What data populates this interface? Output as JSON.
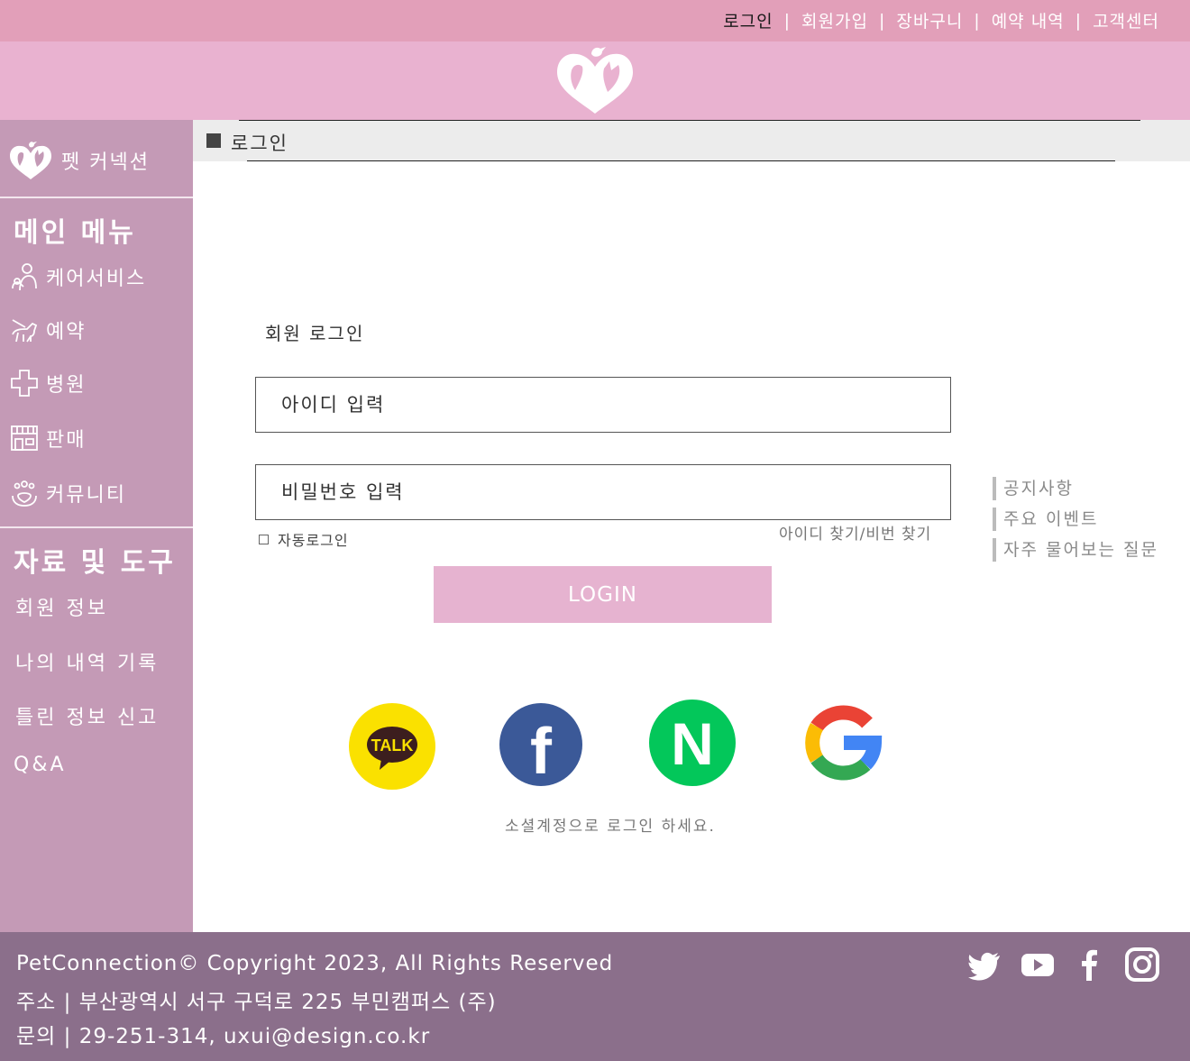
{
  "topnav": {
    "items": [
      "로그인",
      "회원가입",
      "장바구니",
      "예약 내역",
      "고객센터"
    ],
    "separator": "|"
  },
  "sidebar": {
    "brand": "펫 커넥션",
    "main_title": "메인 메뉴",
    "main_items": [
      {
        "label": "케어서비스",
        "icon": "caregiver-icon"
      },
      {
        "label": "예약",
        "icon": "dog-walk-icon"
      },
      {
        "label": "병원",
        "icon": "medical-cross-icon"
      },
      {
        "label": "판매",
        "icon": "store-icon"
      },
      {
        "label": "커뮤니티",
        "icon": "community-icon"
      }
    ],
    "tools_title": "자료 및 도구",
    "tool_items": [
      "회원 정보",
      "나의 내역 기록",
      "틀린 정보 신고",
      "Q&A"
    ]
  },
  "breadcrumb": {
    "label": "로그인"
  },
  "login": {
    "title": "회원 로그인",
    "id_placeholder": "아이디 입력",
    "pw_placeholder": "비밀번호 입력",
    "auto_login": "자동로그인",
    "find_link": "아이디 찾기/비번 찾기",
    "button": "LOGIN",
    "social_note": "소셜계정으로 로그인 하세요."
  },
  "social": [
    {
      "name": "kakao",
      "label": "TALK"
    },
    {
      "name": "facebook",
      "label": "f"
    },
    {
      "name": "naver",
      "label": "N"
    },
    {
      "name": "google",
      "label": "G"
    }
  ],
  "side_links": [
    "공지사항",
    "주요 이벤트",
    "자주 물어보는 질문"
  ],
  "footer": {
    "copyright": "PetConnection© Copyright 2023, All Rights Reserved",
    "address": "주소 | 부산광역시 서구 구덕로 225 부민캠퍼스 (주)",
    "contact": "문의 | 29-251-314, uxui@design.co.kr",
    "icons": [
      "twitter-icon",
      "youtube-icon",
      "facebook-icon",
      "instagram-icon"
    ]
  },
  "colors": {
    "topbar": "#e29fb9",
    "header": "#e9b2d0",
    "sidebar": "#c49ab6",
    "footer": "#8b6f8b",
    "login_button": "#e6b3d0",
    "kakao": "#fae100",
    "facebook": "#3b5998",
    "naver": "#03c75a"
  }
}
